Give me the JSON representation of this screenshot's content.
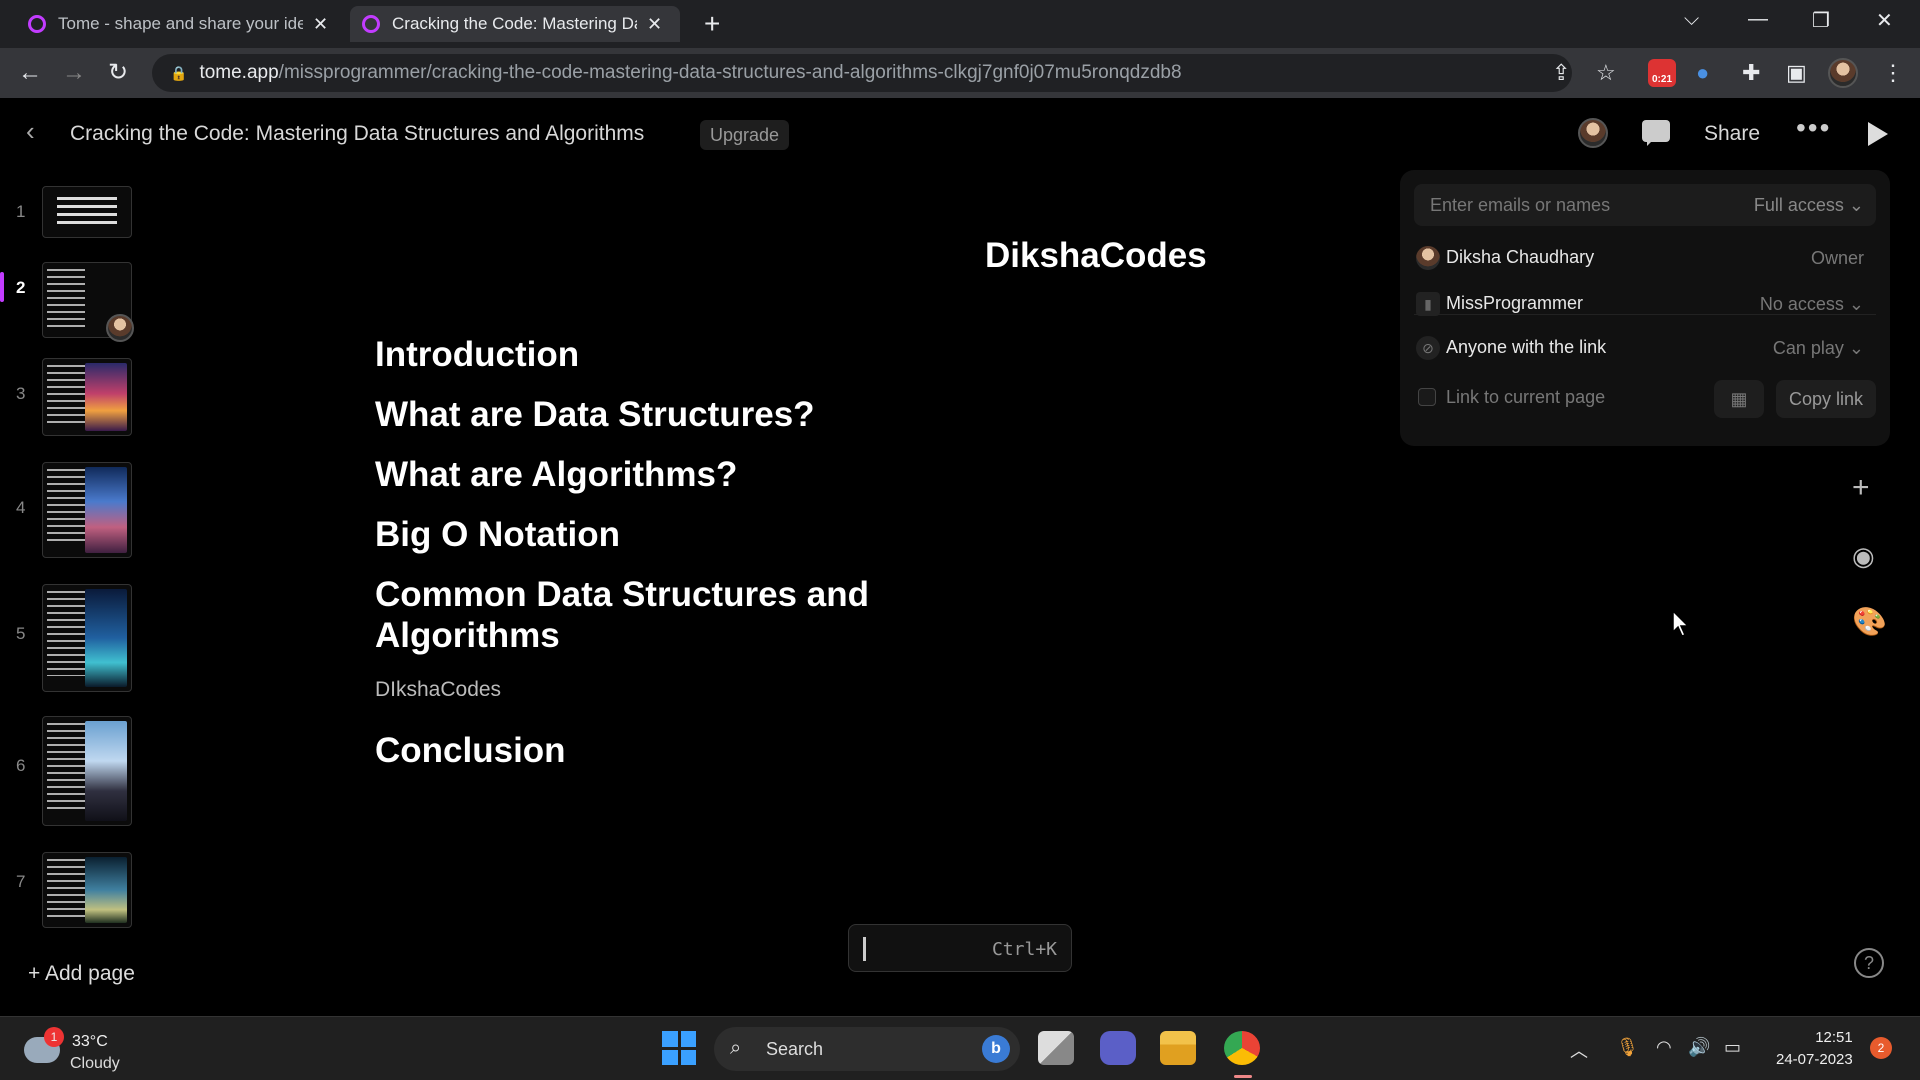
{
  "browser": {
    "tabs": [
      {
        "title": "Tome - shape and share your ide",
        "active": false
      },
      {
        "title": "Cracking the Code: Mastering Da",
        "active": true
      }
    ],
    "url_host": "tome.app",
    "url_path": "/missprogrammer/cracking-the-code-mastering-data-structures-and-algorithms-clkgj7gnf0j07mu5ronqdzdb8",
    "extension_badge": "0:21"
  },
  "header": {
    "title": "Cracking the Code: Mastering Data Structures and Algorithms",
    "upgrade_label": "Upgrade",
    "share_label": "Share"
  },
  "sidebar": {
    "pages": [
      {
        "number": "1",
        "active": false
      },
      {
        "number": "2",
        "active": true
      },
      {
        "number": "3",
        "active": false
      },
      {
        "number": "4",
        "active": false
      },
      {
        "number": "5",
        "active": false
      },
      {
        "number": "6",
        "active": false
      },
      {
        "number": "7",
        "active": false
      }
    ],
    "add_page_label": "Add page"
  },
  "slide": {
    "brand": "DikshaCodes",
    "toc": [
      "Introduction",
      "What are Data Structures?",
      "What are Algorithms?",
      "Big O Notation",
      "Common Data Structures and Algorithms",
      "Conclusion"
    ],
    "sub_label": "DIkshaCodes"
  },
  "command_bar": {
    "shortcut": "Ctrl+K"
  },
  "share_panel": {
    "email_placeholder": "Enter emails or names",
    "default_access": "Full access",
    "members": [
      {
        "name": "Diksha Chaudhary",
        "permission": "Owner"
      },
      {
        "name": "MissProgrammer",
        "permission": "No access"
      }
    ],
    "link_row": {
      "label": "Anyone with the link",
      "permission": "Can play"
    },
    "link_current_page_label": "Link to current page",
    "copy_link_label": "Copy link"
  },
  "taskbar": {
    "weather_temp": "33°C",
    "weather_cond": "Cloudy",
    "weather_badge": "1",
    "search_label": "Search",
    "time": "12:51",
    "date": "24-07-2023",
    "notification_count": "2"
  },
  "colors": {
    "accent": "#c23cff",
    "background": "#000000"
  }
}
